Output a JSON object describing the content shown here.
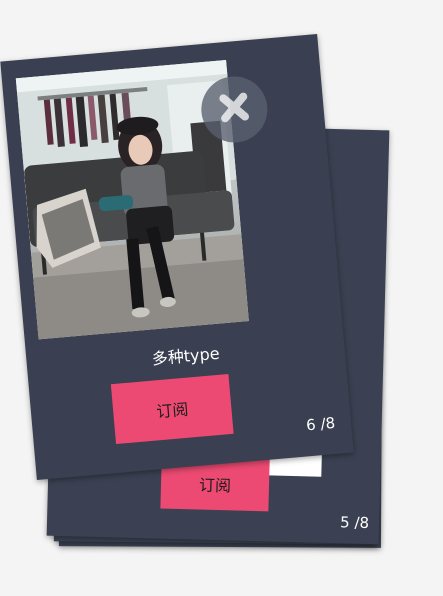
{
  "cards": {
    "front": {
      "title": "多种type",
      "subscribe_label": "订阅",
      "counter": "6 /8",
      "close_icon": "close-x-icon"
    },
    "back": {
      "subscribe_label": "订阅",
      "counter": "5 /8"
    }
  },
  "colors": {
    "card_bg": "#3b4152",
    "accent": "#ec4a72",
    "page_bg": "#f4f4f4"
  }
}
